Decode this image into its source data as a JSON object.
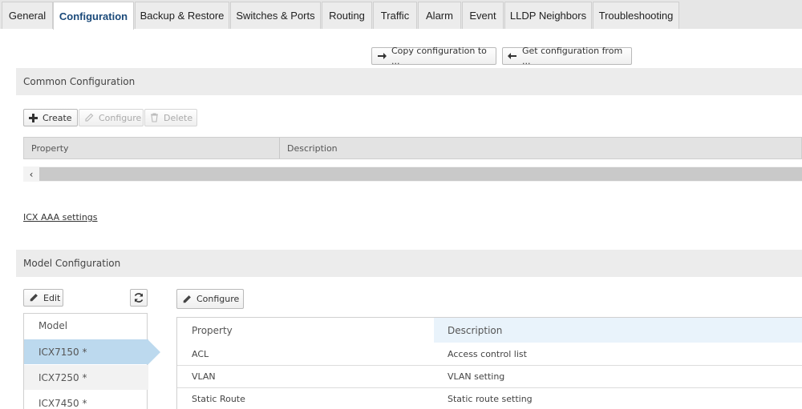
{
  "tabs": [
    {
      "label": "General",
      "active": false
    },
    {
      "label": "Configuration",
      "active": true
    },
    {
      "label": "Backup & Restore",
      "active": false
    },
    {
      "label": "Switches & Ports",
      "active": false
    },
    {
      "label": "Routing",
      "active": false
    },
    {
      "label": "Traffic",
      "active": false
    },
    {
      "label": "Alarm",
      "active": false
    },
    {
      "label": "Event",
      "active": false
    },
    {
      "label": "LLDP Neighbors",
      "active": false
    },
    {
      "label": "Troubleshooting",
      "active": false
    }
  ],
  "top_actions": {
    "copy_label": "Copy configuration to ...",
    "get_label": "Get configuration from ..."
  },
  "common": {
    "title": "Common Configuration",
    "create_label": "Create",
    "configure_label": "Configure",
    "delete_label": "Delete",
    "columns": [
      "Property",
      "Description"
    ],
    "scroll_left": "‹",
    "link_label": "ICX AAA settings"
  },
  "model": {
    "title": "Model Configuration",
    "edit_label": "Edit",
    "configure_label": "Configure",
    "list_header": "Model",
    "items": [
      {
        "label": "ICX7150 *",
        "selected": true
      },
      {
        "label": "ICX7250 *",
        "selected": false
      },
      {
        "label": "ICX7450 *",
        "selected": false
      }
    ],
    "columns": [
      "Property",
      "Description"
    ],
    "rows": [
      {
        "property": "ACL",
        "description": "Access control list"
      },
      {
        "property": "VLAN",
        "description": "VLAN setting"
      },
      {
        "property": "Static Route",
        "description": "Static route setting"
      }
    ]
  },
  "colors": {
    "active_tab_text": "#1b4a7a",
    "selected_row": "#bcd9ee",
    "header_bg": "#ececec"
  }
}
